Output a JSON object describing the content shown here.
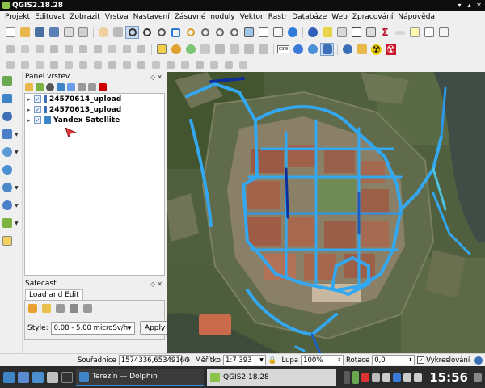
{
  "window": {
    "title": "QGIS2.18.28"
  },
  "menu": [
    "Projekt",
    "Editovat",
    "Zobrazit",
    "Vrstva",
    "Nastavení",
    "Zásuvné moduly",
    "Vektor",
    "Rastr",
    "Databáze",
    "Web",
    "Zpracování",
    "Nápověda"
  ],
  "layers_panel": {
    "title": "Panel vrstev",
    "layers": [
      {
        "name": "24570614_upload",
        "expanded": false,
        "checked": true
      },
      {
        "name": "24570613_upload",
        "expanded": false,
        "checked": true
      },
      {
        "name": "Yandex Satellite",
        "expanded": false,
        "checked": true
      }
    ]
  },
  "safecast_panel": {
    "title": "Safecast",
    "tab": "Load and Edit",
    "style_label": "Style:",
    "style_value": "0.08 - 5.00 microSv/h",
    "apply_label": "Apply"
  },
  "statusbar": {
    "coord_label": "Souřadnice",
    "coord_value": "1574336,6534916",
    "scale_label": "Měřítko",
    "scale_value": "1:7 393",
    "magnifier_label": "Lupa",
    "magnifier_value": "100%",
    "rotation_label": "Rotace",
    "rotation_value": "0,0",
    "render_label": "Vykreslování"
  },
  "taskbar": {
    "items": [
      {
        "label": "Terezín — Dolphin"
      },
      {
        "label": "QGIS2.18.28"
      }
    ],
    "clock": "15:56"
  },
  "colors": {
    "track_cyan": "#33a8f0",
    "track_dark": "#0d2f9a",
    "title_bg": "#0d0d0d",
    "taskbar_bg": "#2b2b2b"
  }
}
